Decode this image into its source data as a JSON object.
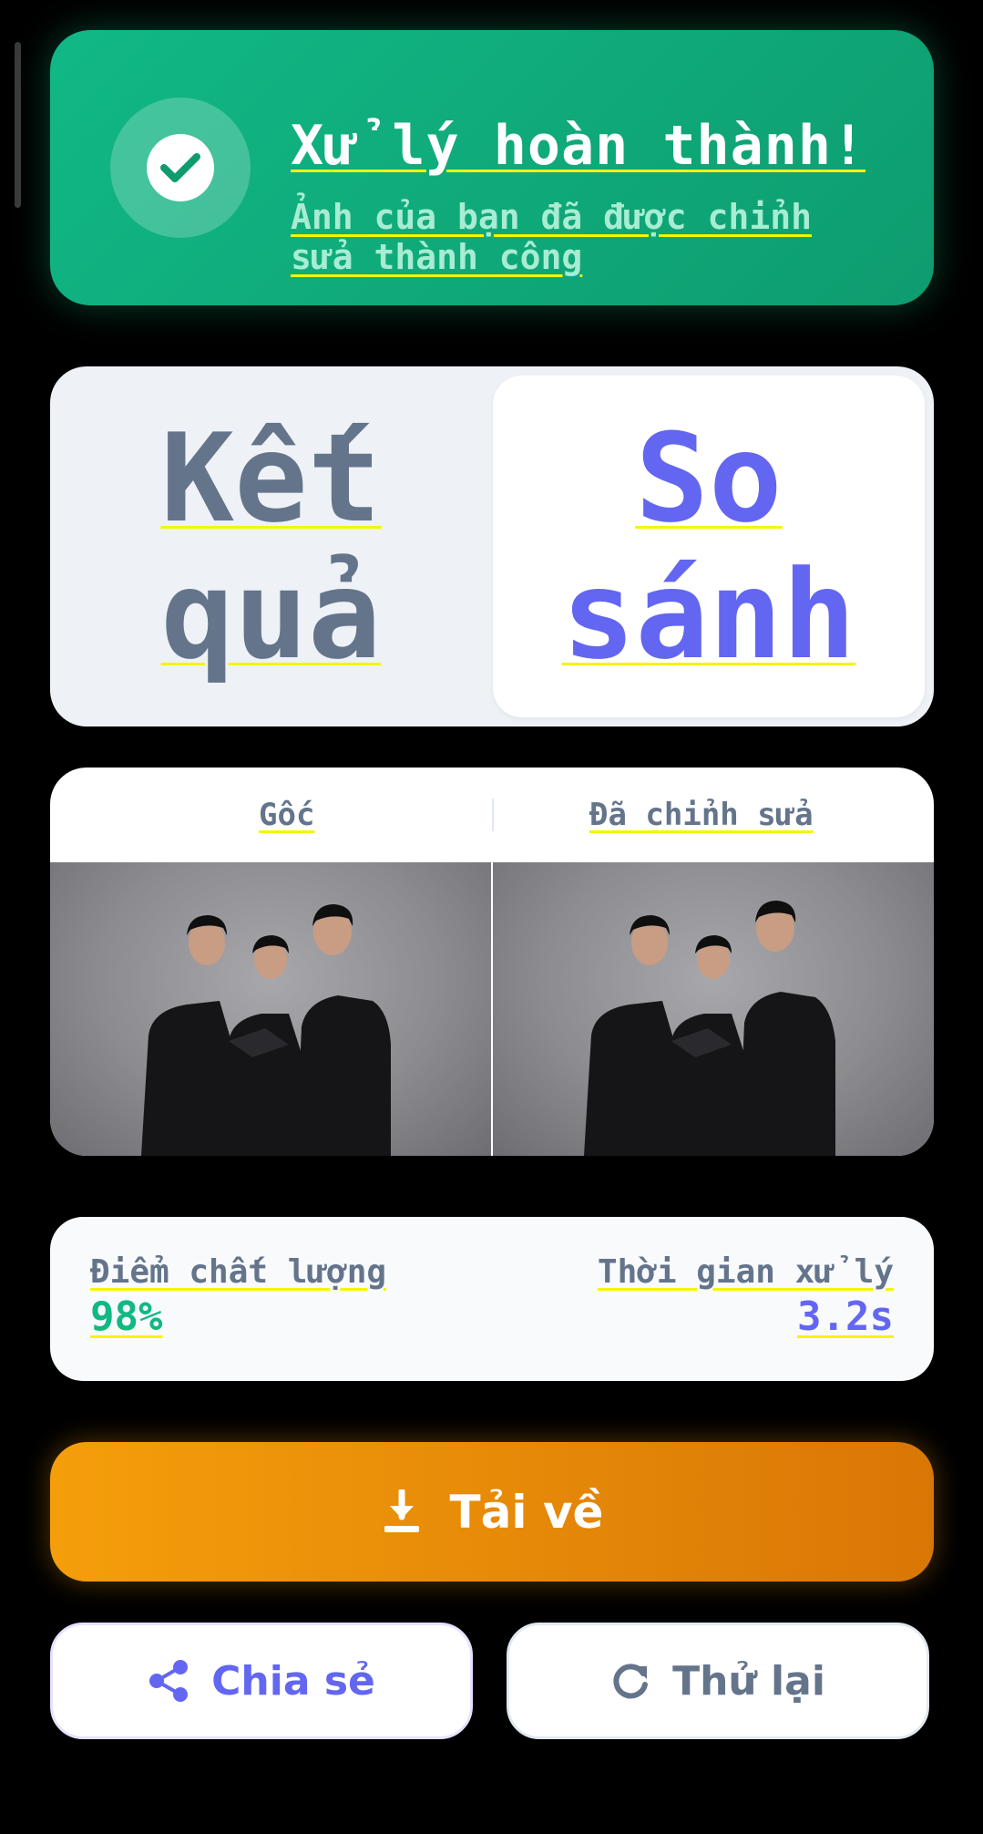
{
  "success": {
    "title": "Xử lý hoàn thành!",
    "subtitle": "Ảnh của bạn đã được chỉnh sửa thành công",
    "icon": "check-icon",
    "color": "#10b981"
  },
  "view_toggle": {
    "options": [
      "Kết quả",
      "So sánh"
    ],
    "selected": "So sánh",
    "active_color": "#6366f1"
  },
  "comparison": {
    "original_label": "Gốc",
    "edited_label": "Đã chỉnh sửa"
  },
  "metrics": {
    "quality_label": "Điểm chất lượng",
    "quality_value": "98%",
    "quality_color": "#10b981",
    "time_label": "Thời gian xử lý",
    "time_value": "3.2s",
    "time_color": "#6366f1"
  },
  "actions": {
    "download_label": "Tải về",
    "download_icon": "download-icon",
    "share_label": "Chia sẻ",
    "share_icon": "share-icon",
    "retry_label": "Thử lại",
    "retry_icon": "refresh-icon"
  }
}
